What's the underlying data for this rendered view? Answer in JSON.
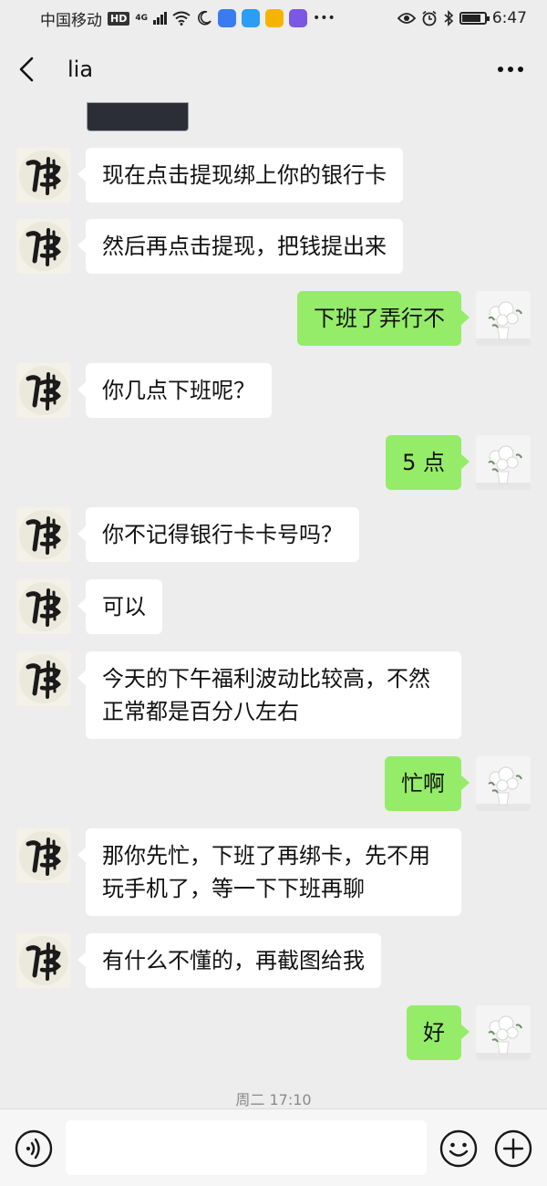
{
  "status_bar": {
    "carrier": "中国移动",
    "hd": "HD",
    "network": "4G",
    "time": "6:47",
    "icons": [
      "wifi-icon",
      "moon-icon",
      "eye-icon",
      "alarm-icon",
      "bluetooth-icon",
      "battery-icon"
    ]
  },
  "header": {
    "title": "lia",
    "back_icon": "chevron-left-icon",
    "more_icon": "more-dots-icon"
  },
  "messages": [
    {
      "side": "left",
      "text": "现在点击提现绑上你的银行卡"
    },
    {
      "side": "left",
      "text": "然后再点击提现，把钱提出来"
    },
    {
      "side": "right",
      "text": "下班了弄行不"
    },
    {
      "side": "left",
      "text": "你几点下班呢？"
    },
    {
      "side": "right",
      "text": "5 点"
    },
    {
      "side": "left",
      "text": "你不记得银行卡卡号吗？"
    },
    {
      "side": "left",
      "text": "可以"
    },
    {
      "side": "left",
      "text": "今天的下午福利波动比较高，不然正常都是百分八左右"
    },
    {
      "side": "right",
      "text": "忙啊"
    },
    {
      "side": "left",
      "text": "那你先忙，下班了再绑卡，先不用玩手机了，等一下下班再聊"
    },
    {
      "side": "left",
      "text": "有什么不懂的，再截图给我"
    },
    {
      "side": "right",
      "text": "好"
    }
  ],
  "timestamp": "周二 17:10",
  "input_bar": {
    "placeholder": "",
    "voice_icon": "voice-icon",
    "emoji_icon": "emoji-icon",
    "plus_icon": "plus-icon"
  },
  "colors": {
    "background": "#ededed",
    "bubble_self": "#95ec69",
    "bubble_other": "#ffffff"
  }
}
